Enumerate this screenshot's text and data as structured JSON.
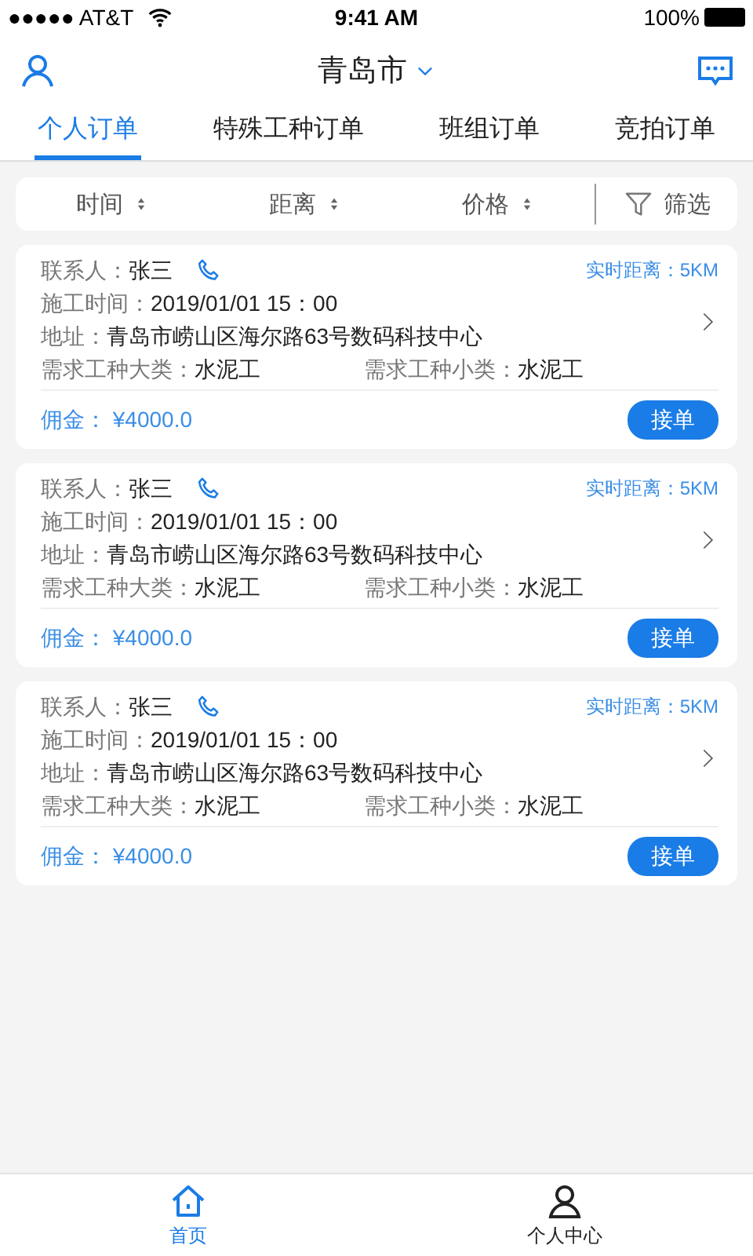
{
  "status_bar": {
    "carrier": "●●●●● AT&T",
    "time": "9:41 AM",
    "battery": "100%"
  },
  "header": {
    "city": "青岛市"
  },
  "tabs": [
    {
      "label": "个人订单",
      "selected": true
    },
    {
      "label": "特殊工种订单",
      "selected": false
    },
    {
      "label": "班组订单",
      "selected": false
    },
    {
      "label": "竞拍订单",
      "selected": false
    }
  ],
  "sort_bar": {
    "sorts": [
      "时间",
      "距离",
      "价格"
    ],
    "filter": "筛选"
  },
  "orders": [
    {
      "contact_label": "联系人：",
      "contact": "张三",
      "distance": "实时距离：5KM",
      "time_label": "施工时间：",
      "time": "2019/01/01  15：00",
      "address_label": "地址：",
      "address": "青岛市崂山区海尔路63号数码科技中心",
      "major_label": "需求工种大类：",
      "major": "水泥工",
      "minor_label": "需求工种小类：",
      "minor": "水泥工",
      "commission": "佣金：  ¥4000.0",
      "action": "接单"
    },
    {
      "contact_label": "联系人：",
      "contact": "张三",
      "distance": "实时距离：5KM",
      "time_label": "施工时间：",
      "time": "2019/01/01  15：00",
      "address_label": "地址：",
      "address": "青岛市崂山区海尔路63号数码科技中心",
      "major_label": "需求工种大类：",
      "major": "水泥工",
      "minor_label": "需求工种小类：",
      "minor": "水泥工",
      "commission": "佣金：  ¥4000.0",
      "action": "接单"
    },
    {
      "contact_label": "联系人：",
      "contact": "张三",
      "distance": "实时距离：5KM",
      "time_label": "施工时间：",
      "time": "2019/01/01  15：00",
      "address_label": "地址：",
      "address": "青岛市崂山区海尔路63号数码科技中心",
      "major_label": "需求工种大类：",
      "major": "水泥工",
      "minor_label": "需求工种小类：",
      "minor": "水泥工",
      "commission": "佣金：  ¥4000.0",
      "action": "接单"
    }
  ],
  "bottom_nav": [
    {
      "label": "首页",
      "kind": "home",
      "selected": true
    },
    {
      "label": "个人中心",
      "kind": "profile",
      "selected": false
    }
  ]
}
